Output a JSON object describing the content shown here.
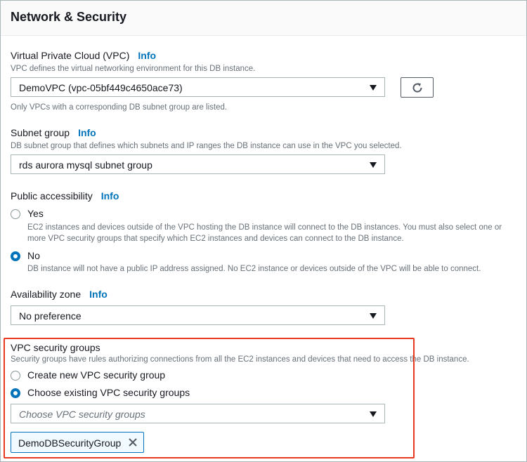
{
  "header": {
    "title": "Network & Security"
  },
  "vpc": {
    "label": "Virtual Private Cloud (VPC)",
    "info": "Info",
    "description": "VPC defines the virtual networking environment for this DB instance.",
    "selected": "DemoVPC (vpc-05bf449c4650ace73)",
    "hint": "Only VPCs with a corresponding DB subnet group are listed."
  },
  "subnet": {
    "label": "Subnet group",
    "info": "Info",
    "description": "DB subnet group that defines which subnets and IP ranges the DB instance can use in the VPC you selected.",
    "selected": "rds aurora mysql subnet group"
  },
  "public_access": {
    "label": "Public accessibility",
    "info": "Info",
    "options": [
      {
        "label": "Yes",
        "description": "EC2 instances and devices outside of the VPC hosting the DB instance will connect to the DB instances. You must also select one or more VPC security groups that specify which EC2 instances and devices can connect to the DB instance.",
        "checked": false
      },
      {
        "label": "No",
        "description": "DB instance will not have a public IP address assigned. No EC2 instance or devices outside of the VPC will be able to connect.",
        "checked": true
      }
    ]
  },
  "az": {
    "label": "Availability zone",
    "info": "Info",
    "selected": "No preference"
  },
  "security_groups": {
    "label": "VPC security groups",
    "description": "Security groups have rules authorizing connections from all the EC2 instances and devices that need to access the DB instance.",
    "options": [
      {
        "label": "Create new VPC security group",
        "checked": false
      },
      {
        "label": "Choose existing VPC security groups",
        "checked": true
      }
    ],
    "placeholder": "Choose VPC security groups",
    "tokens": [
      "DemoDBSecurityGroup"
    ]
  },
  "colors": {
    "accent": "#0073bb",
    "highlight": "#e8381d",
    "muted_text": "#687078"
  },
  "icons": {
    "refresh": "refresh-icon",
    "caret": "caret-down-icon",
    "remove": "close-icon"
  }
}
